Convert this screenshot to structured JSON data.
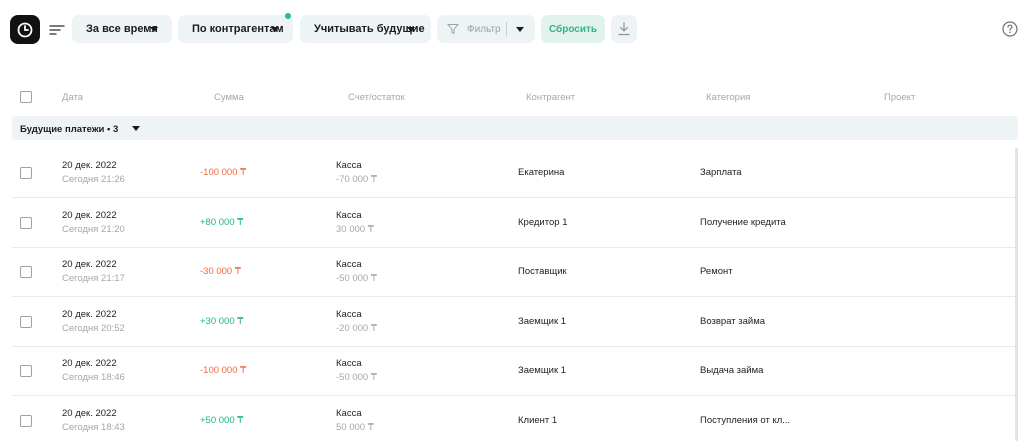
{
  "toolbar": {
    "period_label": "За все время",
    "group_label": "По контрагентам",
    "future_label": "Учитывать будущие",
    "filter_label": "Фильтр",
    "reset_label": "Сбросить"
  },
  "columns": {
    "date": "Дата",
    "sum": "Сумма",
    "account": "Счет/остаток",
    "counterparty": "Контрагент",
    "category": "Категория",
    "project": "Проект"
  },
  "group": {
    "label": "Будущие платежи • 3"
  },
  "rows": [
    {
      "date": "20 дек. 2022",
      "time": "Сегодня 21:26",
      "sum": "-100 000 ₸",
      "sign": "neg",
      "account": "Касса",
      "balance": "-70 000 ₸",
      "counterparty": "Екатерина",
      "category": "Зарплата"
    },
    {
      "date": "20 дек. 2022",
      "time": "Сегодня 21:20",
      "sum": "+80 000 ₸",
      "sign": "pos",
      "account": "Касса",
      "balance": "30 000 ₸",
      "counterparty": "Кредитор 1",
      "category": "Получение кредита"
    },
    {
      "date": "20 дек. 2022",
      "time": "Сегодня 21:17",
      "sum": "-30 000 ₸",
      "sign": "neg",
      "account": "Касса",
      "balance": "-50 000 ₸",
      "counterparty": "Поставщик",
      "category": "Ремонт"
    },
    {
      "date": "20 дек. 2022",
      "time": "Сегодня 20:52",
      "sum": "+30 000 ₸",
      "sign": "pos",
      "account": "Касса",
      "balance": "-20 000 ₸",
      "counterparty": "Заемщик 1",
      "category": "Возврат займа"
    },
    {
      "date": "20 дек. 2022",
      "time": "Сегодня 18:46",
      "sum": "-100 000 ₸",
      "sign": "neg",
      "account": "Касса",
      "balance": "-50 000 ₸",
      "counterparty": "Заемщик 1",
      "category": "Выдача займа"
    },
    {
      "date": "20 дек. 2022",
      "time": "Сегодня 18:43",
      "sum": "+50 000 ₸",
      "sign": "pos",
      "account": "Касса",
      "balance": "50 000 ₸",
      "counterparty": "Клиент 1",
      "category": "Поступления от кл..."
    }
  ],
  "colors": {
    "negative": "#f06b3f",
    "positive": "#1fb57f",
    "accent": "#2fb48a",
    "pill_bg": "#eef3f5"
  },
  "icons": {
    "history": "clock-icon",
    "sort": "sort-lines-icon",
    "filter": "funnel-icon",
    "download": "download-icon",
    "help": "question-icon"
  }
}
